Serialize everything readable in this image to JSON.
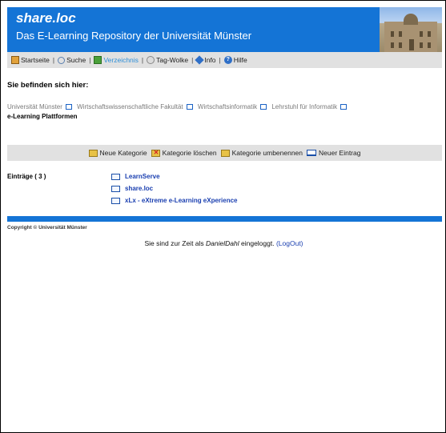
{
  "header": {
    "title": "share.loc",
    "subtitle": "Das E-Learning Repository der Universität Münster",
    "banner_color": "#1474d6"
  },
  "nav": {
    "items": [
      {
        "label": "Startseite",
        "icon": "home-icon"
      },
      {
        "label": "Suche",
        "icon": "search-icon"
      },
      {
        "label": "Verzeichnis",
        "icon": "directory-icon",
        "active": true
      },
      {
        "label": "Tag-Wolke",
        "icon": "tag-cloud-icon"
      },
      {
        "label": "Info",
        "icon": "info-icon"
      },
      {
        "label": "Hilfe",
        "icon": "help-icon"
      }
    ],
    "separator": "|"
  },
  "location": {
    "heading": "Sie befinden sich hier:",
    "breadcrumb": [
      "Universität Münster",
      "Wirtschaftswissenschaftliche Fakultät",
      "Wirtschaftsinformatik",
      "Lehrstuhl für Informatik"
    ],
    "current": "e-Learning Plattformen"
  },
  "toolbar": {
    "new_category": "Neue Kategorie",
    "delete_category": "Kategorie löschen",
    "rename_category": "Kategorie umbenennen",
    "new_entry": "Neuer Eintrag"
  },
  "entries": {
    "label": "Einträge ( 3 )",
    "items": [
      "LearnServe",
      "share.loc",
      "xLx - eXtreme e-Learning eXperience"
    ]
  },
  "footer": {
    "copyright": "Copyright © Universität Münster",
    "login_prefix": "Sie sind zur Zeit als",
    "user": "DanielDahl",
    "login_suffix": "eingeloggt.",
    "logout": "(LogOut)"
  }
}
